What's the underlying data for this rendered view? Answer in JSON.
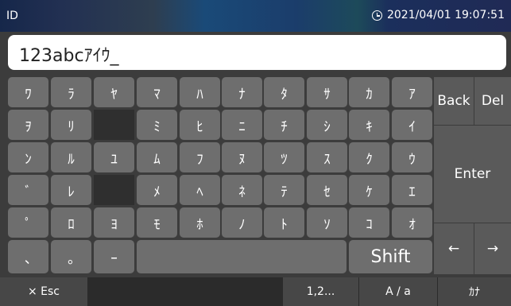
{
  "header": {
    "title": "ID",
    "datetime": "2021/04/01 19:07:51"
  },
  "input": {
    "value": "123abcｱｲｳ_"
  },
  "keyboard": {
    "rows": [
      [
        "ﾜ",
        "ﾗ",
        "ﾔ",
        "ﾏ",
        "ﾊ",
        "ﾅ",
        "ﾀ",
        "ｻ",
        "ｶ",
        "ｱ"
      ],
      [
        "ｦ",
        "ﾘ",
        "",
        "ﾐ",
        "ﾋ",
        "ﾆ",
        "ﾁ",
        "ｼ",
        "ｷ",
        "ｲ"
      ],
      [
        "ﾝ",
        "ﾙ",
        "ﾕ",
        "ﾑ",
        "ﾌ",
        "ﾇ",
        "ﾂ",
        "ｽ",
        "ｸ",
        "ｳ"
      ],
      [
        "ﾞ",
        "ﾚ",
        "",
        "ﾒ",
        "ﾍ",
        "ﾈ",
        "ﾃ",
        "ｾ",
        "ｹ",
        "ｴ"
      ],
      [
        "ﾟ",
        "ﾛ",
        "ﾖ",
        "ﾓ",
        "ﾎ",
        "ﾉ",
        "ﾄ",
        "ｿ",
        "ｺ",
        "ｵ"
      ]
    ],
    "last_row": {
      "comma": "､",
      "period": "｡",
      "dash": "ｰ",
      "space": "",
      "shift": "Shift"
    },
    "side": {
      "back": "Back",
      "del": "Del",
      "enter": "Enter",
      "left": "←",
      "right": "→"
    }
  },
  "bottom": {
    "esc": "× Esc",
    "numbers": "1,2...",
    "case": "A / a",
    "kana": "ｶﾅ"
  }
}
